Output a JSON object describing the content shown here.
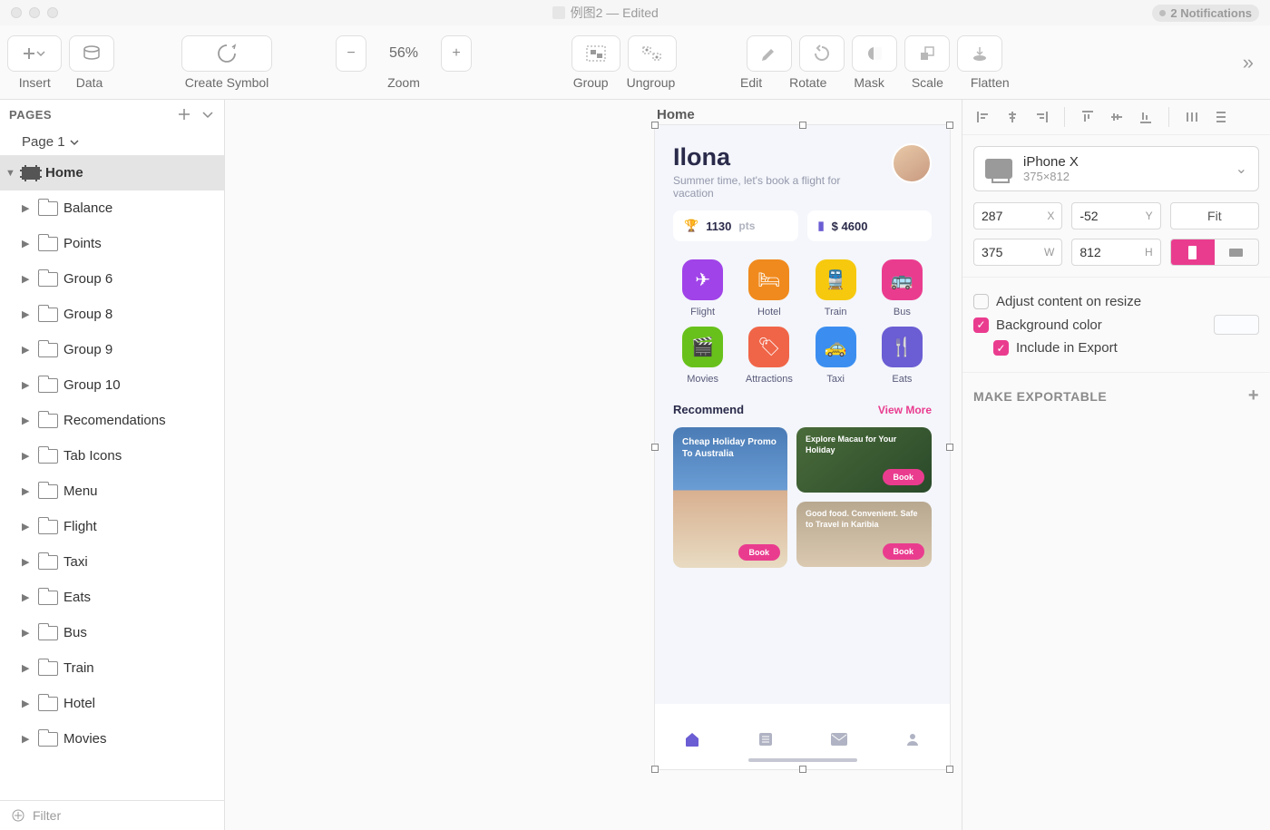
{
  "window": {
    "title": "例图2 — Edited",
    "notifications": "2 Notifications"
  },
  "toolbar": {
    "insert": "Insert",
    "data": "Data",
    "create_symbol": "Create Symbol",
    "zoom": "Zoom",
    "zoom_value": "56%",
    "group": "Group",
    "ungroup": "Ungroup",
    "edit": "Edit",
    "rotate": "Rotate",
    "mask": "Mask",
    "scale": "Scale",
    "flatten": "Flatten"
  },
  "left_panel": {
    "pages_label": "PAGES",
    "page_name": "Page 1",
    "selected_artboard": "Home",
    "layers": [
      "Balance",
      "Points",
      "Group 6",
      "Group 8",
      "Group 9",
      "Group 10",
      "Recomendations",
      "Tab Icons",
      "Menu",
      "Flight",
      "Taxi",
      "Eats",
      "Bus",
      "Train",
      "Hotel",
      "Movies"
    ],
    "filter_placeholder": "Filter"
  },
  "canvas": {
    "artboard_label": "Home"
  },
  "app": {
    "greeting": "Ilona",
    "subtitle": "Summer time, let's book a flight for vacation",
    "points_value": "1130",
    "points_unit": "pts",
    "balance_value": "$ 4600",
    "categories": [
      {
        "label": "Flight",
        "color": "#a043e8",
        "glyph": "✈"
      },
      {
        "label": "Hotel",
        "color": "#f08a1e",
        "glyph": "🛏"
      },
      {
        "label": "Train",
        "color": "#f6c90e",
        "glyph": "🚆"
      },
      {
        "label": "Bus",
        "color": "#ea3c8f",
        "glyph": "🚌"
      },
      {
        "label": "Movies",
        "color": "#68c11b",
        "glyph": "🎬"
      },
      {
        "label": "Attractions",
        "color": "#f06548",
        "glyph": "🏷"
      },
      {
        "label": "Taxi",
        "color": "#3b8ef0",
        "glyph": "🚕"
      },
      {
        "label": "Eats",
        "color": "#6b5dd3",
        "glyph": "🍴"
      }
    ],
    "recommend_title": "Recommend",
    "recommend_more": "View More",
    "rec1": "Cheap Holiday Promo To Australia",
    "rec2": "Explore Macau for Your Holiday",
    "rec3": "Good food. Convenient. Safe to Travel in Karibia",
    "book": "Book"
  },
  "inspector": {
    "device_name": "iPhone X",
    "device_dim": "375×812",
    "x": "287",
    "y": "-52",
    "w": "375",
    "h": "812",
    "fit": "Fit",
    "adjust_content": "Adjust content on resize",
    "background_color": "Background color",
    "include_export": "Include in Export",
    "make_exportable": "MAKE EXPORTABLE"
  }
}
